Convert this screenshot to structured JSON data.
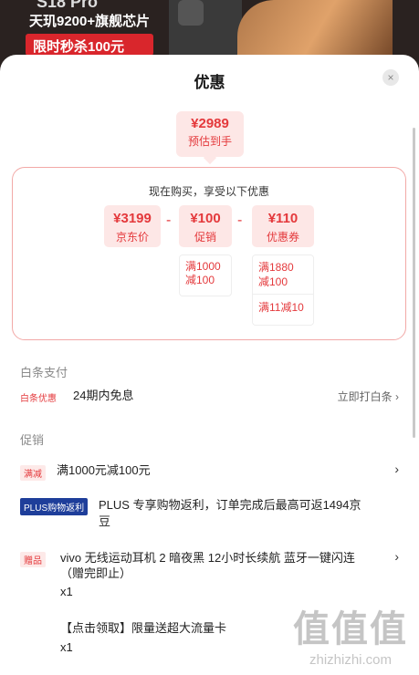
{
  "banner": {
    "model": "S18 Pro",
    "chip": "天玑9200+旗舰芯片",
    "flash": "限时秒杀100元"
  },
  "sheet": {
    "title": "优惠",
    "close": "×"
  },
  "estimate": {
    "price": "¥2989",
    "label": "预估到手"
  },
  "offer": {
    "heading": "现在购买，享受以下优惠",
    "items": [
      {
        "value": "¥3199",
        "label": "京东价"
      },
      {
        "value": "¥100",
        "label": "促销"
      },
      {
        "value": "¥110",
        "label": "优惠券"
      }
    ],
    "ops": [
      "-",
      "-"
    ],
    "promo_rules": [
      "满1000",
      "减100"
    ],
    "coupon_rules": [
      "满1880",
      "减100",
      "满11减10"
    ]
  },
  "baitiao": {
    "title": "白条支付",
    "tag": "白条优惠",
    "text": "24期内免息",
    "link": "立即打白条 ›"
  },
  "promo": {
    "title": "促销",
    "rows": [
      {
        "tag": "满减",
        "text": "满1000元减100元"
      },
      {
        "tag": "PLUS购物返利",
        "text_1": "PLUS 专享购物返利，订单完成后最高可返1494京",
        "text_2": "豆"
      },
      {
        "tag": "赠品",
        "text_1": "vivo 无线运动耳机 2 暗夜黑 12小时长续航 蓝牙一键闪连",
        "text_2": "（赠完即止）",
        "qty_1": "x1",
        "gift_2": "【点击领取】限量送超大流量卡",
        "qty_2": "x1"
      }
    ],
    "chevron": "›"
  },
  "watermark": {
    "big": "值值值",
    "small": "zhizhizhi.com"
  }
}
